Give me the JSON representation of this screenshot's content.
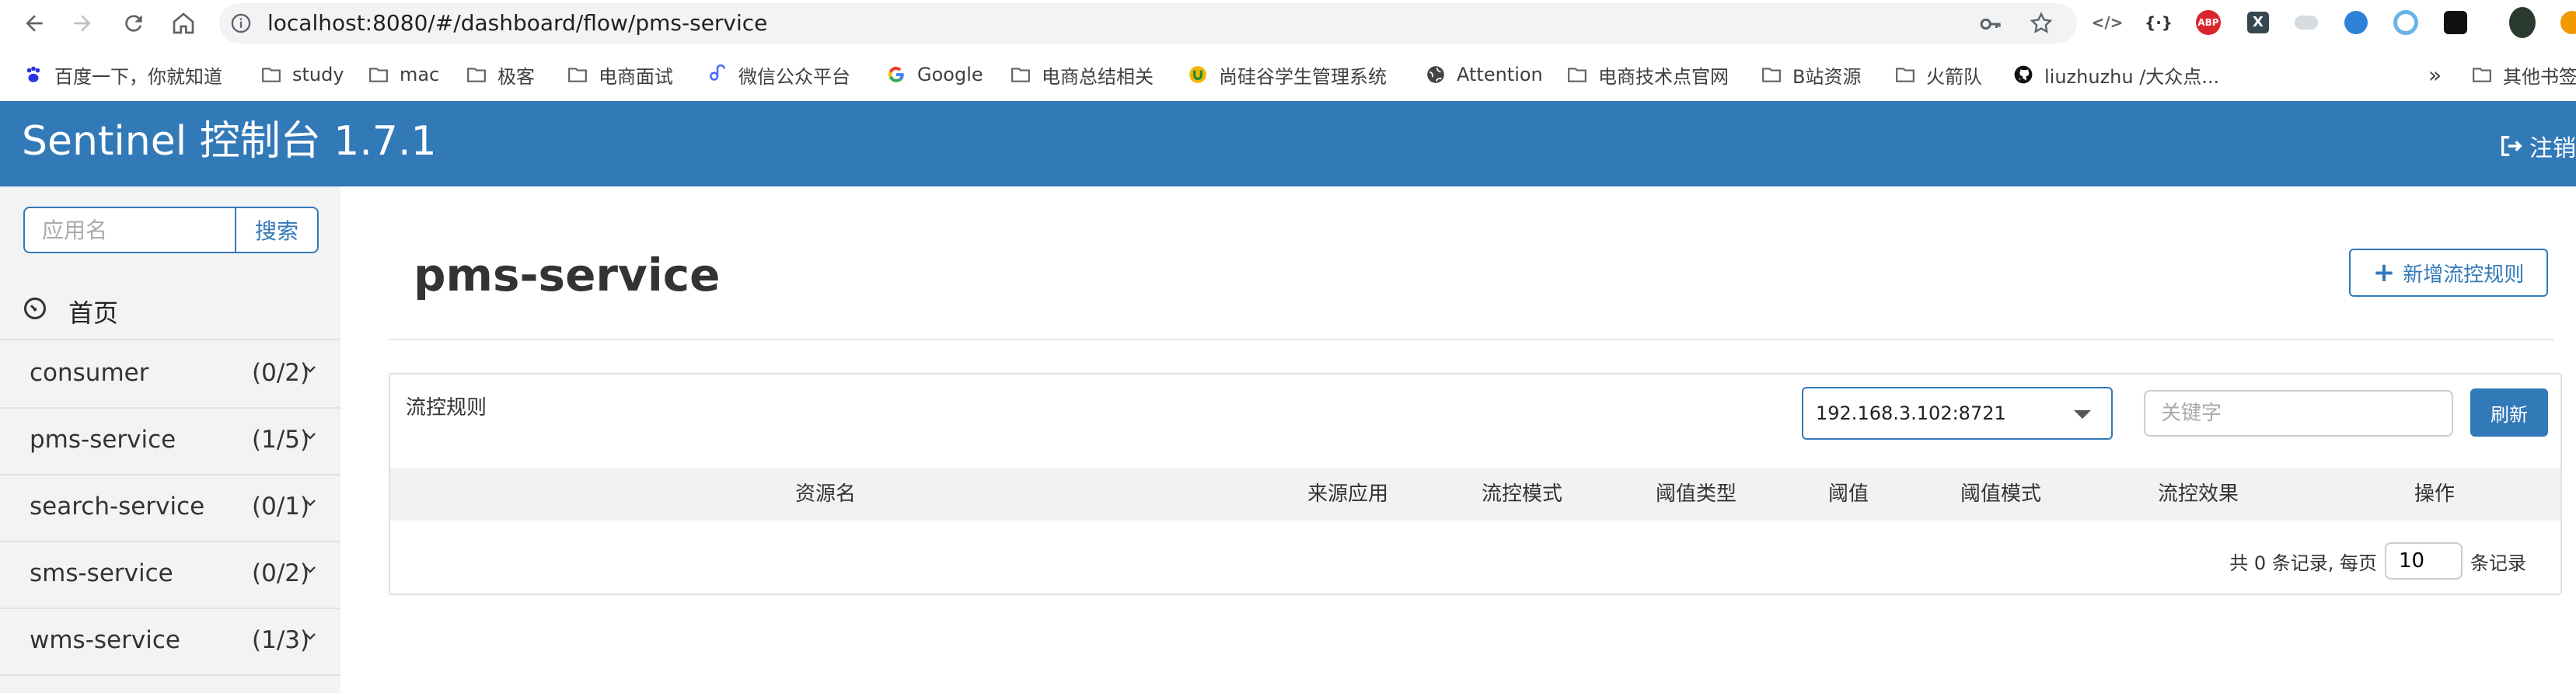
{
  "browser": {
    "url": "localhost:8080/#/dashboard/flow/pms-service",
    "bookmarks": [
      {
        "label": "百度一下，你就知道",
        "icon": "baidu-icon"
      },
      {
        "label": "study",
        "icon": "folder-icon"
      },
      {
        "label": "mac",
        "icon": "folder-icon"
      },
      {
        "label": "极客",
        "icon": "folder-icon"
      },
      {
        "label": "电商面试",
        "icon": "folder-icon"
      },
      {
        "label": "微信公众平台",
        "icon": "wechat-mp-icon"
      },
      {
        "label": "Google",
        "icon": "google-icon"
      },
      {
        "label": "电商总结相关",
        "icon": "folder-icon"
      },
      {
        "label": "尚硅谷学生管理系统",
        "icon": "atguigu-icon"
      },
      {
        "label": "Attention",
        "icon": "globe-icon"
      },
      {
        "label": "电商技术点官网",
        "icon": "folder-icon"
      },
      {
        "label": "B站资源",
        "icon": "folder-icon"
      },
      {
        "label": "火箭队",
        "icon": "folder-icon"
      },
      {
        "label": "liuzhuzhu /大众点...",
        "icon": "github-icon"
      }
    ],
    "more_bookmarks": "»",
    "other_bookmarks": "其他书签"
  },
  "header": {
    "title": "Sentinel 控制台 1.7.1",
    "logout_label": "注销"
  },
  "sidebar": {
    "search_placeholder": "应用名",
    "search_label": "搜索",
    "home_label": "首页",
    "apps": [
      {
        "name": "consumer",
        "count": "(0/2)"
      },
      {
        "name": "pms-service",
        "count": "(1/5)"
      },
      {
        "name": "search-service",
        "count": "(0/1)"
      },
      {
        "name": "sms-service",
        "count": "(0/2)"
      },
      {
        "name": "wms-service",
        "count": "(1/3)"
      }
    ]
  },
  "main": {
    "title": "pms-service",
    "add_rule_label": "新增流控规则",
    "panel_title": "流控规则",
    "machine": "192.168.3.102:8721",
    "keyword_placeholder": "关键字",
    "refresh_label": "刷新",
    "columns": [
      "资源名",
      "来源应用",
      "流控模式",
      "阈值类型",
      "阈值",
      "阈值模式",
      "流控效果",
      "操作"
    ],
    "pager_prefix": "共 0 条记录, 每页",
    "page_size": "10",
    "pager_suffix": "条记录"
  },
  "colors": {
    "header_bg": "#3279b8",
    "sidebar_bg": "#f3f3f3",
    "accent": "#3279b8"
  }
}
